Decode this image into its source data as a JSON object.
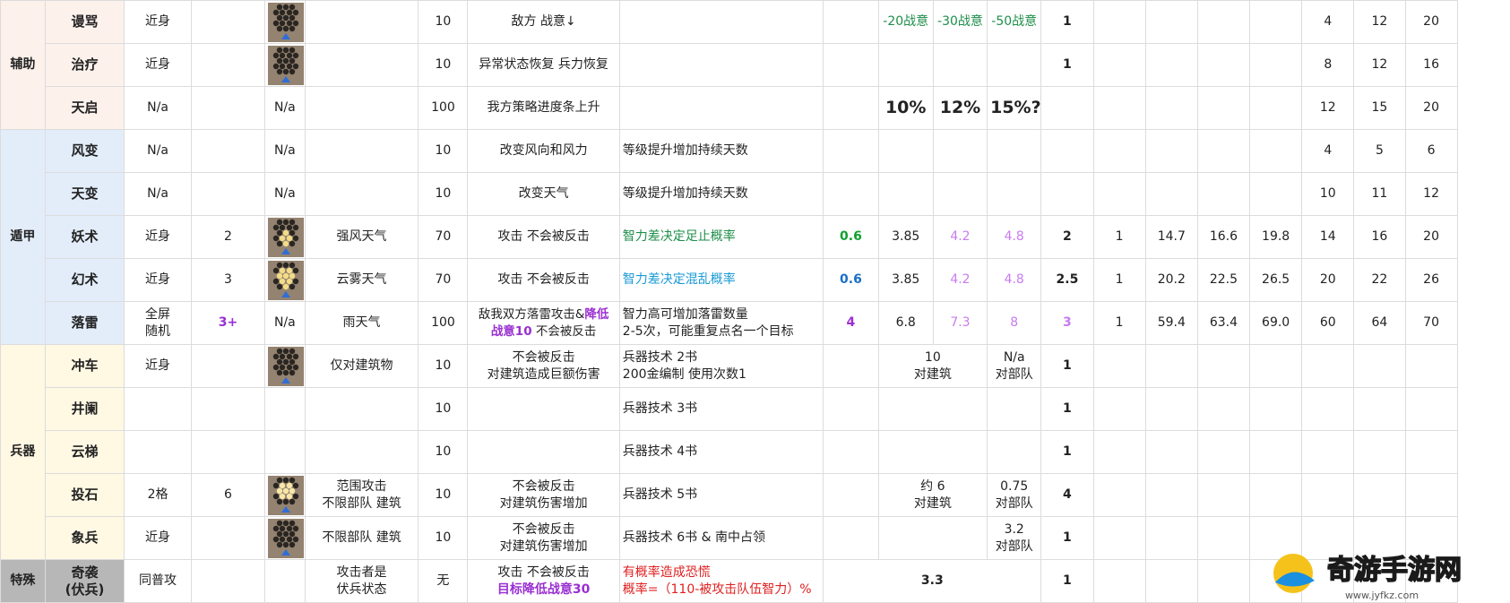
{
  "colors": {
    "green": "#1e8e4a",
    "cyan": "#1a9ad6",
    "violet": "#c77cf0",
    "purple": "#9a2fd2",
    "red": "#e02020",
    "blue": "#1a6fc8",
    "brightgreen": "#10a030"
  },
  "categories": {
    "aux": "辅助",
    "dun": "遁甲",
    "bing": "兵器",
    "te": "特殊"
  },
  "rows": [
    {
      "name": "谩骂",
      "range": "近身",
      "r3": "",
      "pattern": "a",
      "cond": "",
      "cost": "10",
      "effect": "敌方 战意↓",
      "note": "",
      "coef": "",
      "v1": "-20战意",
      "v2": "-30战意",
      "v3": "-50战意",
      "lvl": "1",
      "c1": "",
      "c2": "",
      "c3": "",
      "c4": "",
      "t1": "4",
      "t2": "12",
      "t3": "20"
    },
    {
      "name": "治疗",
      "range": "近身",
      "r3": "",
      "pattern": "a",
      "cond": "",
      "cost": "10",
      "effect": "异常状态恢复 兵力恢复",
      "note": "",
      "coef": "",
      "v1": "",
      "v2": "",
      "v3": "",
      "lvl": "1",
      "c1": "",
      "c2": "",
      "c3": "",
      "c4": "",
      "t1": "8",
      "t2": "12",
      "t3": "16"
    },
    {
      "name": "天启",
      "range": "N/a",
      "r3": "",
      "pattern": "N/a",
      "cond": "",
      "cost": "100",
      "effect": "我方策略进度条上升",
      "note": "",
      "coef": "",
      "v1": "10%",
      "v2": "12%",
      "v3": "15%?",
      "lvl": "",
      "c1": "",
      "c2": "",
      "c3": "",
      "c4": "",
      "t1": "12",
      "t2": "15",
      "t3": "20"
    },
    {
      "name": "风变",
      "range": "N/a",
      "r3": "",
      "pattern": "N/a",
      "cond": "",
      "cost": "10",
      "effect": "改变风向和风力",
      "note": "等级提升增加持续天数",
      "coef": "",
      "v1": "",
      "v2": "",
      "v3": "",
      "lvl": "",
      "c1": "",
      "c2": "",
      "c3": "",
      "c4": "",
      "t1": "4",
      "t2": "5",
      "t3": "6"
    },
    {
      "name": "天变",
      "range": "N/a",
      "r3": "",
      "pattern": "N/a",
      "cond": "",
      "cost": "10",
      "effect": "改变天气",
      "note": "等级提升增加持续天数",
      "coef": "",
      "v1": "",
      "v2": "",
      "v3": "",
      "lvl": "",
      "c1": "",
      "c2": "",
      "c3": "",
      "c4": "",
      "t1": "10",
      "t2": "11",
      "t3": "12"
    },
    {
      "name": "妖术",
      "range": "近身",
      "r3": "2",
      "pattern": "b",
      "cond": "强风天气",
      "cost": "70",
      "effect": "攻击 不会被反击",
      "note": "智力差决定足止概率",
      "coef": "0.6",
      "v1": "3.85",
      "v2": "4.2",
      "v3": "4.8",
      "lvl": "2",
      "c1": "1",
      "c2": "14.7",
      "c3": "16.6",
      "c4": "19.8",
      "t1": "14",
      "t2": "16",
      "t3": "20"
    },
    {
      "name": "幻术",
      "range": "近身",
      "r3": "3",
      "pattern": "c",
      "cond": "云雾天气",
      "cost": "70",
      "effect": "攻击 不会被反击",
      "note": "智力差决定混乱概率",
      "coef": "0.6",
      "v1": "3.85",
      "v2": "4.2",
      "v3": "4.8",
      "lvl": "2.5",
      "c1": "1",
      "c2": "20.2",
      "c3": "22.5",
      "c4": "26.5",
      "t1": "20",
      "t2": "22",
      "t3": "26"
    },
    {
      "name": "落雷",
      "range": "全屏\n随机",
      "r3": "3+",
      "pattern": "N/a",
      "cond": "雨天气",
      "cost": "100",
      "effect1": "敌我双方落雷攻击&",
      "effect2": "降低",
      "effect3": "战意10",
      "effect4": " 不会被反击",
      "note": "智力高可增加落雷数量\n2-5次，可能重复点名一个目标",
      "coef": "4",
      "v1": "6.8",
      "v2": "7.3",
      "v3": "8",
      "lvl": "3",
      "c1": "1",
      "c2": "59.4",
      "c3": "63.4",
      "c4": "69.0",
      "t1": "60",
      "t2": "64",
      "t3": "70"
    },
    {
      "name": "冲车",
      "range": "近身",
      "r3": "",
      "pattern": "a",
      "cond": "仅对建筑物",
      "cost": "10",
      "effect": "不会被反击\n对建筑造成巨额伤害",
      "note": "兵器技术 2书\n200金编制 使用次数1",
      "coef": "",
      "v12": "10\n对建筑",
      "v3": "N/a\n对部队",
      "lvl": "1"
    },
    {
      "name": "井阑",
      "range": "",
      "r3": "",
      "pattern": "",
      "cond": "",
      "cost": "10",
      "effect": "",
      "note": "兵器技术 3书",
      "coef": "",
      "v12": "",
      "v3": "",
      "lvl": "1"
    },
    {
      "name": "云梯",
      "range": "",
      "r3": "",
      "pattern": "",
      "cond": "",
      "cost": "10",
      "effect": "",
      "note": "兵器技术 4书",
      "coef": "",
      "v12": "",
      "v3": "",
      "lvl": "1"
    },
    {
      "name": "投石",
      "range": "2格",
      "r3": "6",
      "pattern": "d",
      "cond": "范围攻击\n不限部队 建筑",
      "cost": "10",
      "effect": "不会被反击\n对建筑伤害增加",
      "note": "兵器技术 5书",
      "coef": "",
      "v12": "约 6\n对建筑",
      "v3": "0.75\n对部队",
      "lvl": "4"
    },
    {
      "name": "象兵",
      "range": "近身",
      "r3": "",
      "pattern": "a",
      "cond": "不限部队 建筑",
      "cost": "10",
      "effect": "不会被反击\n对建筑伤害增加",
      "note": "兵器技术 6书 & 南中占领",
      "coef": "",
      "v12": "",
      "v3": "3.2\n对部队",
      "lvl": "1"
    },
    {
      "name": "奇袭\n(伏兵)",
      "range": "同普攻",
      "r3": "",
      "pattern": "",
      "cond": "攻击者是\n伏兵状态",
      "cost": "无",
      "effect1": "攻击 不会被反击",
      "effect2": "目标降低战意30",
      "note1": "有概率造成恐慌",
      "note2": "概率=（110-被攻击队伍智力）%",
      "vall": "3.3",
      "lvl": "1"
    }
  ],
  "watermark": {
    "text": "奇游手游网",
    "url": "www.jyfkz.com"
  }
}
